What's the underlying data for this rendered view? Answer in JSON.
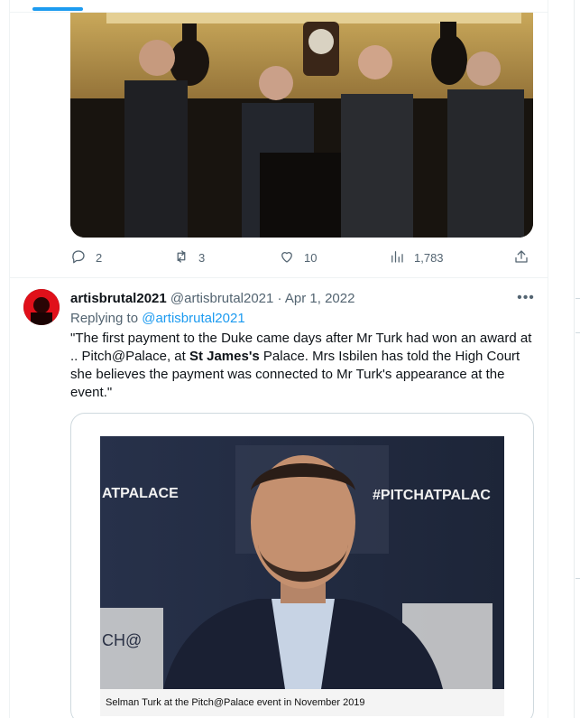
{
  "previous_tweet": {
    "actions": {
      "replies": "2",
      "retweets": "3",
      "likes": "10",
      "views": "1,783"
    }
  },
  "tweet": {
    "display_name": "artisbrutal2021",
    "handle": "@artisbrutal2021",
    "separator": "·",
    "date": "Apr 1, 2022",
    "more_label": "•••",
    "replying_prefix": "Replying to ",
    "replying_handle": "@artisbrutal2021",
    "text_part1": "\"The first payment to the Duke came days after Mr Turk had won an award at .. Pitch@Palace, at ",
    "text_bold": "St James's",
    "text_part2": " Palace. Mrs Isbilen has told the High Court she believes the payment was connected to Mr Turk's appearance at the event.\"",
    "card": {
      "image_text_left": "ATPALACE",
      "image_text_right": "#PITCHATPALAC",
      "image_logo_text": "CH@",
      "caption": "Selman Turk at the Pitch@Palace event in November 2019"
    }
  },
  "colors": {
    "accent": "#1d9bf0",
    "secondary_text": "#536471",
    "border": "#eff3f4"
  }
}
